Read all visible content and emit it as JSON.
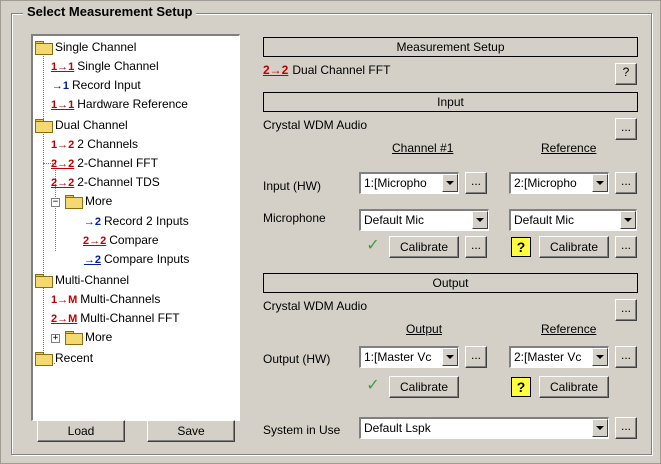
{
  "title": "Select Measurement Setup",
  "tree": {
    "single_channel_folder": "Single Channel",
    "single_channel": "Single Channel",
    "record_input": "Record Input",
    "hardware_reference": "Hardware Reference",
    "dual_channel_folder": "Dual Channel",
    "two_channels": "2 Channels",
    "two_channel_fft": "2-Channel FFT",
    "two_channel_tds": "2-Channel TDS",
    "more1": "More",
    "record_2_inputs": "Record 2 Inputs",
    "compare": "Compare",
    "compare_inputs": "Compare Inputs",
    "multi_channel_folder": "Multi-Channel",
    "multi_channels": "Multi-Channels",
    "multi_channel_fft": "Multi-Channel FFT",
    "more2": "More",
    "recent": "Recent",
    "expand_minus": "−",
    "expand_plus": "+"
  },
  "icons": {
    "one_arrow_one": "1→1",
    "arrow_one": "→1",
    "one_arrow_two": "1→2",
    "two_arrow_two": "2→2",
    "arrow_two": "→2",
    "one_arrow_multi": "1→M",
    "two_arrow_multi": "2→M"
  },
  "buttons": {
    "load": "Load",
    "save": "Save",
    "ellipsis": "...",
    "help": "?",
    "calibrate": "Calibrate"
  },
  "measurement": {
    "header": "Measurement Setup",
    "current": "Dual Channel FFT"
  },
  "input": {
    "header": "Input",
    "device": "Crystal WDM Audio",
    "col_channel": "Channel #1",
    "col_reference": "Reference",
    "hw_label": "Input (HW)",
    "hw_channel_value": "1:[Micropho",
    "hw_reference_value": "2:[Micropho",
    "mic_label": "Microphone",
    "mic_channel_value": "Default Mic",
    "mic_reference_value": "Default Mic",
    "status_ok": "✓",
    "status_unknown": "?"
  },
  "output": {
    "header": "Output",
    "device": "Crystal WDM Audio",
    "col_output": "Output",
    "col_reference": "Reference",
    "hw_label": "Output (HW)",
    "hw_output_value": "1:[Master Vc",
    "hw_reference_value": "2:[Master Vc",
    "status_ok": "✓",
    "status_unknown": "?"
  },
  "system": {
    "label": "System in Use",
    "value": "Default Lspk"
  }
}
